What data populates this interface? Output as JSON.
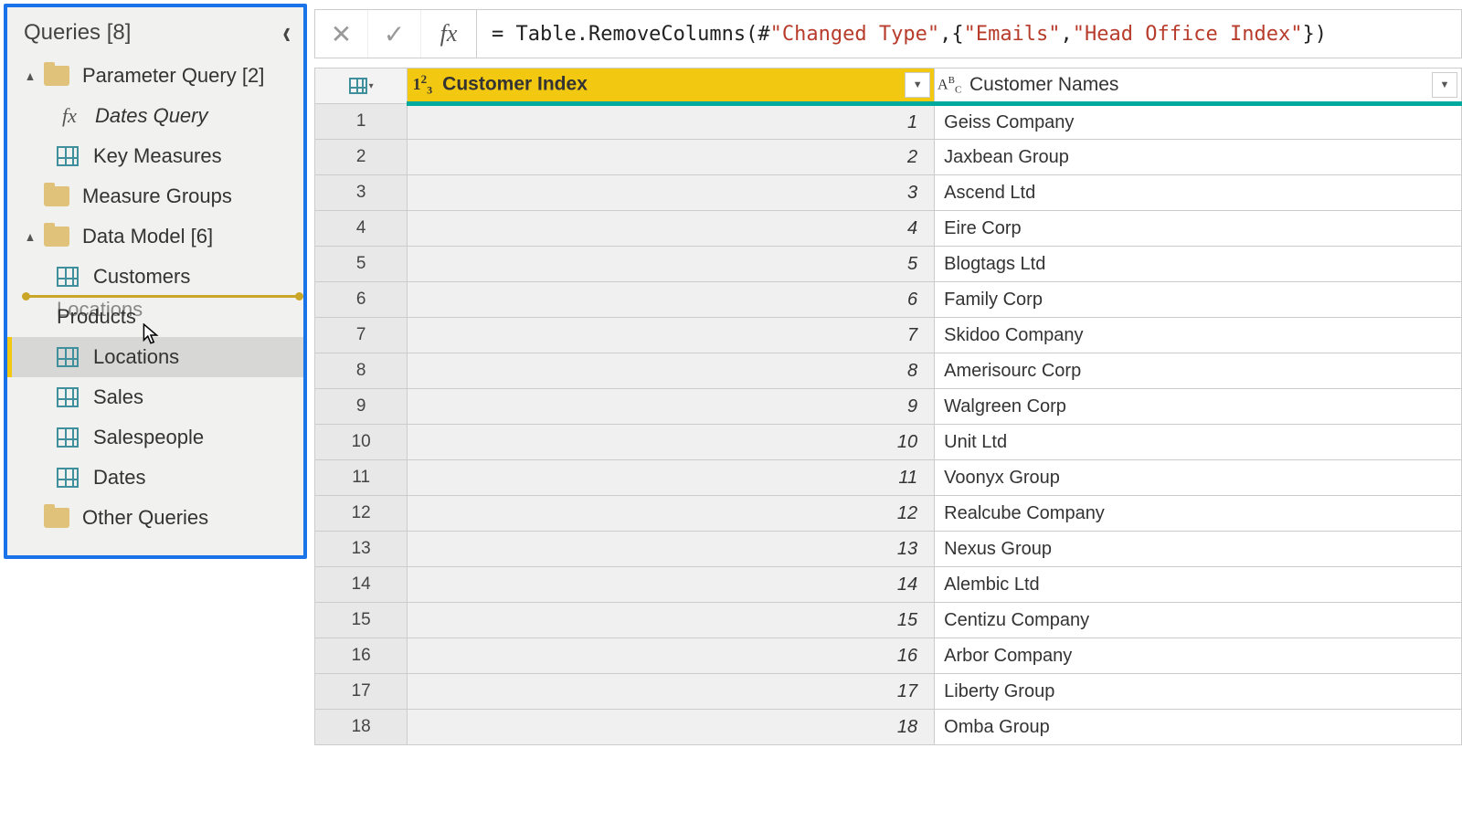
{
  "sidebar": {
    "title": "Queries [8]",
    "chevron": "‹",
    "groups": [
      {
        "label": "Parameter Query [2]",
        "expanded": true,
        "items": [
          {
            "label": "Dates Query",
            "icon": "fx",
            "italic": true
          },
          {
            "label": "Key Measures",
            "icon": "table"
          }
        ]
      },
      {
        "label": "Measure Groups",
        "expanded": false,
        "items": []
      },
      {
        "label": "Data Model [6]",
        "expanded": true,
        "items": [
          {
            "label": "Customers",
            "icon": "table"
          },
          {
            "label_front": "Products",
            "label_ghost": "Locations",
            "icon": "table",
            "drag": true
          },
          {
            "label": "Locations",
            "icon": "table",
            "selected": true
          },
          {
            "label": "Sales",
            "icon": "table"
          },
          {
            "label": "Salespeople",
            "icon": "table"
          },
          {
            "label": "Dates",
            "icon": "table"
          }
        ]
      },
      {
        "label": "Other Queries",
        "expanded": false,
        "items": []
      }
    ]
  },
  "formula": {
    "cancel": "✕",
    "commit": "✓",
    "fx": "fx",
    "prefix": "= Table.RemoveColumns(#",
    "str1": "\"Changed Type\"",
    "mid": ",{",
    "str2": "\"Emails\"",
    "comma": ", ",
    "str3": "\"Head Office Index\"",
    "suffix": "})"
  },
  "columns": {
    "c1": {
      "type": "1²3",
      "label": "Customer Index"
    },
    "c2": {
      "type_label": "Aᴮc",
      "label": "Customer Names"
    }
  },
  "rows": [
    {
      "n": "1",
      "idx": "1",
      "name": "Geiss Company"
    },
    {
      "n": "2",
      "idx": "2",
      "name": "Jaxbean Group"
    },
    {
      "n": "3",
      "idx": "3",
      "name": "Ascend Ltd"
    },
    {
      "n": "4",
      "idx": "4",
      "name": "Eire Corp"
    },
    {
      "n": "5",
      "idx": "5",
      "name": "Blogtags Ltd"
    },
    {
      "n": "6",
      "idx": "6",
      "name": "Family Corp"
    },
    {
      "n": "7",
      "idx": "7",
      "name": "Skidoo Company"
    },
    {
      "n": "8",
      "idx": "8",
      "name": "Amerisourc Corp"
    },
    {
      "n": "9",
      "idx": "9",
      "name": "Walgreen Corp"
    },
    {
      "n": "10",
      "idx": "10",
      "name": "Unit Ltd"
    },
    {
      "n": "11",
      "idx": "11",
      "name": "Voonyx Group"
    },
    {
      "n": "12",
      "idx": "12",
      "name": "Realcube Company"
    },
    {
      "n": "13",
      "idx": "13",
      "name": "Nexus Group"
    },
    {
      "n": "14",
      "idx": "14",
      "name": "Alembic Ltd"
    },
    {
      "n": "15",
      "idx": "15",
      "name": "Centizu Company"
    },
    {
      "n": "16",
      "idx": "16",
      "name": "Arbor Company"
    },
    {
      "n": "17",
      "idx": "17",
      "name": "Liberty Group"
    },
    {
      "n": "18",
      "idx": "18",
      "name": "Omba Group"
    }
  ]
}
